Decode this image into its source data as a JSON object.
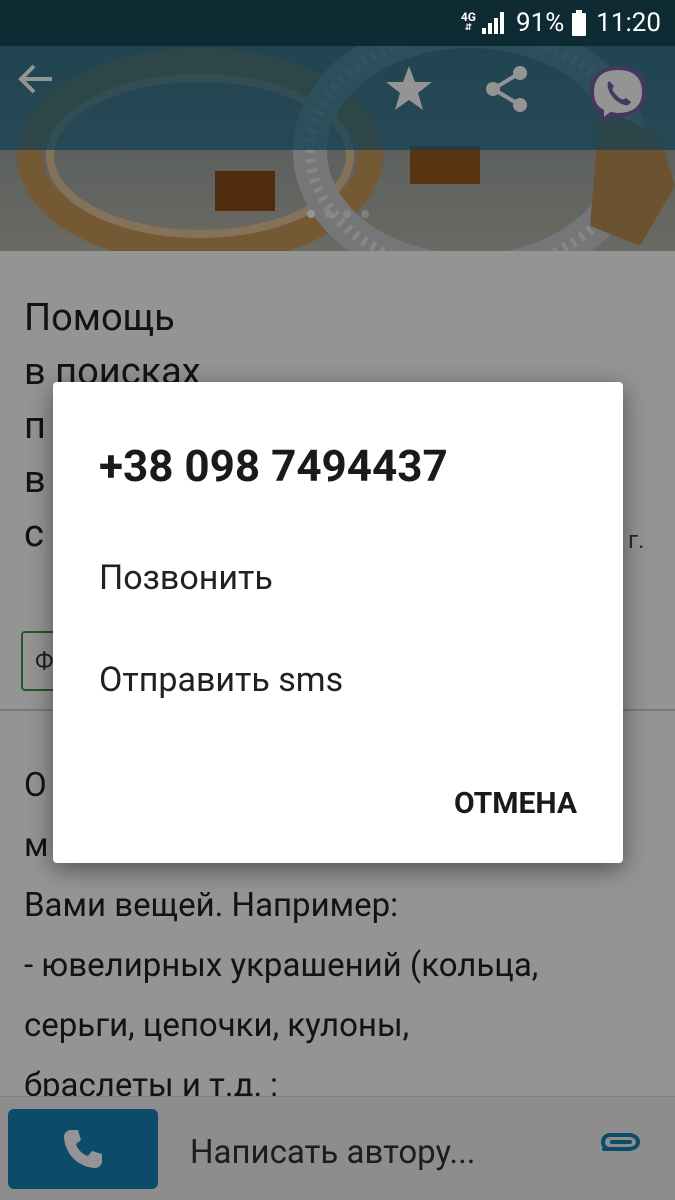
{
  "status_bar": {
    "network": "4G",
    "battery_percent": "91%",
    "time": "11:20"
  },
  "toolbar": {
    "back_icon": "arrow-left-icon",
    "favorite_icon": "star-icon",
    "share_icon": "share-icon",
    "viber_icon": "viber-icon"
  },
  "gallery": {
    "page_count": 4,
    "active_page": 1
  },
  "listing": {
    "title": "Помощь\nв поисках\nп\nв\nс",
    "date_fragment": "г.",
    "category_fragment": "Ф",
    "description_lines": [
      "О",
      "м",
      "Вами вещей. Например:",
      "- ювелирных украшений (кольца,",
      "серьги, цепочки, кулоны,",
      "браслеты и т.д. ;"
    ]
  },
  "bottom_bar": {
    "call_icon": "phone-icon",
    "message_placeholder": "Написать автору...",
    "attach_icon": "paperclip-icon"
  },
  "dialog": {
    "phone": "+38 098 7494437",
    "call_option": "Позвонить",
    "sms_option": "Отправить sms",
    "cancel": "ОТМЕНА"
  },
  "colors": {
    "status_bar": "#0e2a33",
    "toolbar": "#206e8c",
    "call_button": "#1681b5",
    "category_border": "#3a9a4a"
  }
}
